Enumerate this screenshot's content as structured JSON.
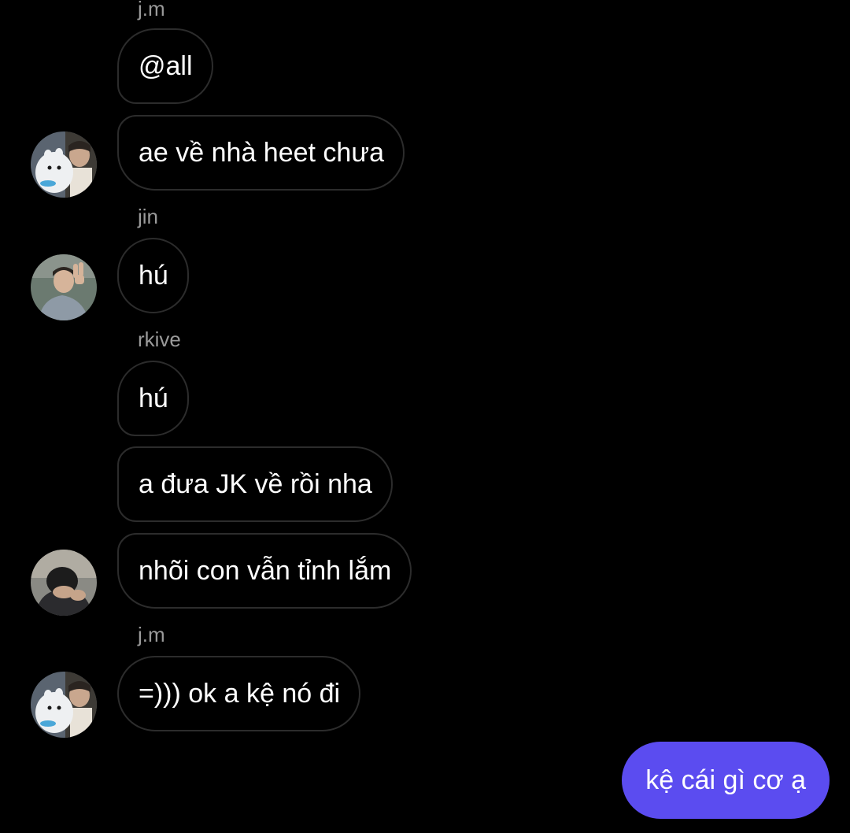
{
  "colors": {
    "background": "#000000",
    "incoming_bubble_border": "#2c2c2c",
    "sender_name": "#9a9a9a",
    "outgoing_bubble": "#5b4cf0"
  },
  "messages": [
    {
      "sender": "j.m",
      "text": "@all"
    },
    {
      "text": "ae về nhà heet chưa",
      "avatar": "jm-avatar-moomin-plush"
    },
    {
      "sender": "jin",
      "text": "hú",
      "avatar": "jin-avatar-peace-sign"
    },
    {
      "sender": "rkive",
      "text": "hú"
    },
    {
      "text": "a đưa JK về rồi nha"
    },
    {
      "text": "nhõi con vẫn tỉnh lắm",
      "avatar": "rkive-avatar-head-down"
    },
    {
      "sender": "j.m",
      "text": "=))) ok a kệ nó đi",
      "avatar": "jm-avatar-moomin-plush"
    }
  ],
  "outgoing": {
    "text": "kệ cái gì cơ ạ"
  }
}
